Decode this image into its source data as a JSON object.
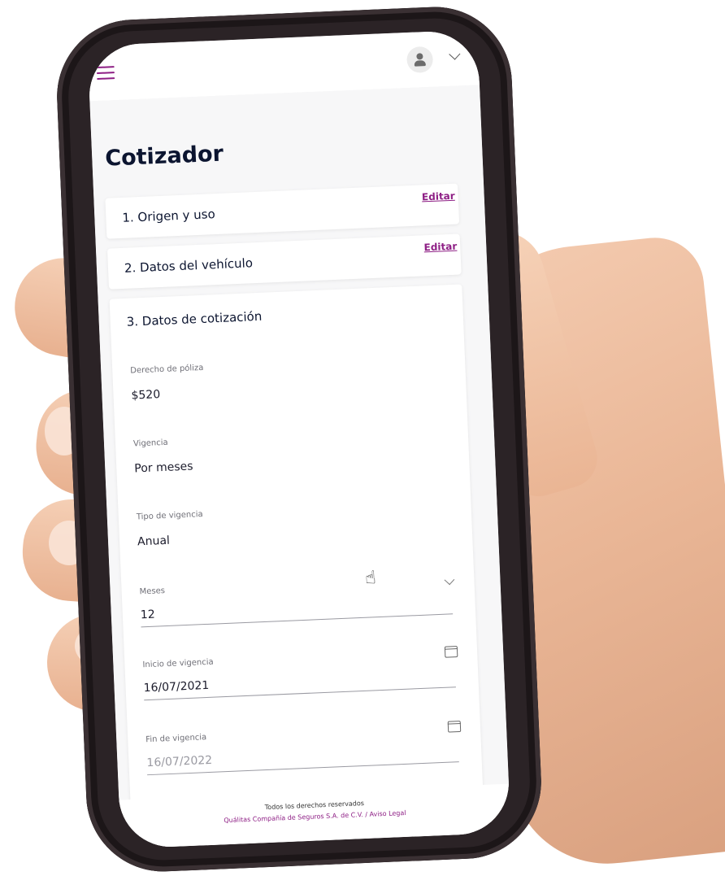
{
  "header": {
    "menu_icon": "hamburger-icon",
    "avatar_icon": "user-icon",
    "dropdown_icon": "chevron-down-icon"
  },
  "page": {
    "title": "Cotizador"
  },
  "steps": [
    {
      "label": "1. Origen y uso",
      "edit_label": "Editar"
    },
    {
      "label": "2. Datos del vehículo",
      "edit_label": "Editar"
    },
    {
      "label": "3. Datos de cotización"
    }
  ],
  "quote": {
    "derecho_poliza": {
      "label": "Derecho de póliza",
      "value": "$520"
    },
    "vigencia": {
      "label": "Vigencia",
      "value": "Por meses"
    },
    "tipo_vigencia": {
      "label": "Tipo de vigencia",
      "value": "Anual"
    },
    "meses": {
      "label": "Meses",
      "value": "12"
    },
    "inicio_vigencia": {
      "label": "Inicio de vigencia",
      "value": "16/07/2021"
    },
    "fin_vigencia": {
      "label": "Fin de vigencia",
      "value": "16/07/2022"
    }
  },
  "footer": {
    "rights": "Todos los derechos reservados",
    "legal": "Quálitas Compañía de Seguros S.A. de C.V. / Aviso Legal"
  },
  "colors": {
    "accent": "#8e1f85",
    "title": "#0c1530"
  }
}
